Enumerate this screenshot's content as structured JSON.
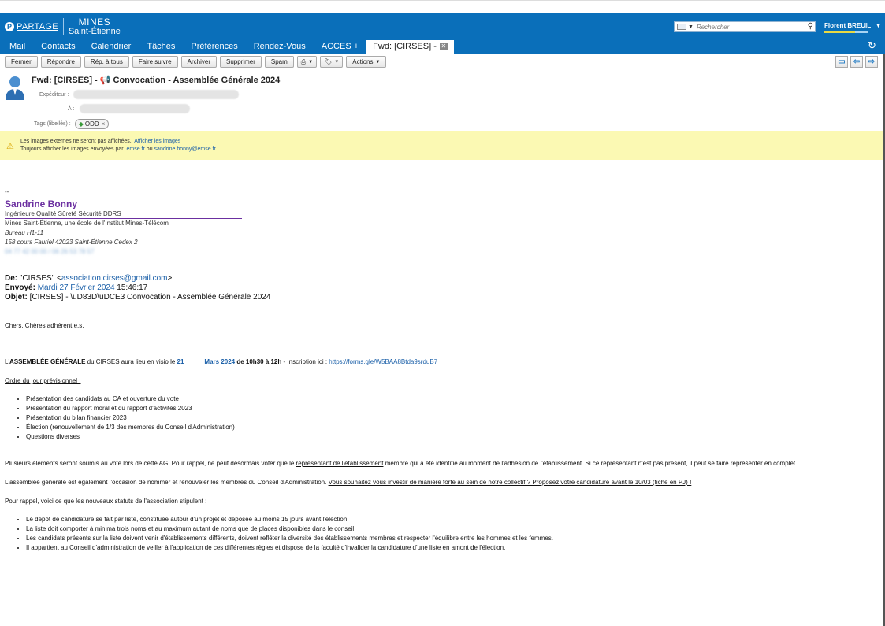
{
  "app": {
    "brand_partage": "PARTAGE",
    "brand_mines_l1": "MINES",
    "brand_mines_l2": "Saint-Étienne",
    "search_placeholder": "Rechercher",
    "user_name": "Florent BREUIL",
    "accent_color": "#0a6fba"
  },
  "tabs": [
    {
      "label": "Mail"
    },
    {
      "label": "Contacts"
    },
    {
      "label": "Calendrier"
    },
    {
      "label": "Tâches"
    },
    {
      "label": "Préférences"
    },
    {
      "label": "Rendez-Vous"
    },
    {
      "label": "ACCES +"
    },
    {
      "label": "Fwd: [CIRSES] -",
      "active": true
    }
  ],
  "toolbar": {
    "close": "Fermer",
    "reply": "Répondre",
    "reply_all": "Rép. à tous",
    "forward": "Faire suivre",
    "archive": "Archiver",
    "delete": "Supprimer",
    "spam": "Spam",
    "actions": "Actions"
  },
  "message": {
    "subject": "Fwd: [CIRSES] - 📢 Convocation - Assemblée Générale 2024",
    "from_label": "Expéditeur :",
    "to_label": "À :",
    "tags_label": "Tags (libellés) :",
    "tag": "ODD"
  },
  "warning": {
    "line1": "Les images externes ne seront pas affichées.",
    "line1_link": "Afficher les images",
    "line2": "Toujours afficher les images envoyées par",
    "line2_link1": "emse.fr",
    "line2_or": "ou",
    "line2_link2": "sandrine.bonny@emse.fr"
  },
  "signature": {
    "dash": "--",
    "name": "Sandrine Bonny",
    "role": "Ingénieure Qualité Sûreté Sécurité DDRS",
    "org": "Mines Saint-Étienne, une école de l'Institut Mines-Télécom",
    "office": "Bureau H1-11",
    "address": "158 cours Fauriel 42023 Saint-Étienne Cedex 2",
    "phone": "04 77 42 00 00 / 06 26 53 78 57"
  },
  "forwarded": {
    "from_label": "De:",
    "from_name": "\"CIRSES\" <",
    "from_email": "association.cirses@gmail.com",
    "from_end": ">",
    "sent_label": "Envoyé:",
    "sent_date": "Mardi 27 Février 2024",
    "sent_time": "15:46:17",
    "subject_label": "Objet:",
    "subject": "[CIRSES] - \\uD83D\\uDCE3 Convocation - Assemblée Générale 2024"
  },
  "body": {
    "greeting": "Chers, Chères adhérent.e.s,",
    "p1_pre": "L'",
    "p1_bold": "ASSEMBLÉE GÉNÉRALE",
    "p1_mid": " du CIRSES aura lieu en visio le ",
    "p1_day": "21",
    "p1_month": "Mars 2024",
    "p1_time": " de 10h30 à 12h",
    "p1_post": " - Inscription ici : ",
    "p1_link": "https://forms.gle/W5BAA8Btda9srduB7",
    "agenda_title": "Ordre du jour prévisionnel :",
    "agenda": [
      "Présentation des candidats au CA et ouverture du vote",
      "Présentation du rapport moral et du rapport d'activités 2023",
      "Présentation du bilan financier 2023",
      "Élection (renouvellement de 1/3 des membres du Conseil d'Administration)",
      "Questions diverses"
    ],
    "p2_pre": "Plusieurs éléments seront soumis au vote lors de cette AG. Pour rappel, ne peut désormais voter que le ",
    "p2_u": "représentant de l'établissement",
    "p2_post": " membre qui a été identifié au moment de l'adhésion de l'établissement. Si ce représentant n'est pas présent, il peut se faire représenter en complét",
    "p3_pre": "L'assemblée générale est également l'occasion de nommer et renouveler les membres du Conseil d'Administration.  ",
    "p3_u": "Vous souhaitez vous investir de manière forte au sein de notre collectif ? Proposez votre candidature avant le 10/03 (fiche en PJ) !",
    "p4": "Pour rappel, voici ce que les nouveaux statuts de l'association stipulent :",
    "rules": [
      "Le dépôt de candidature se fait par liste, constituée autour d'un projet et déposée au moins 15 jours avant l'élection.",
      "La liste doit comporter à minima trois noms et au maximum autant de noms que de places disponibles dans le conseil.",
      "Les candidats présents sur la liste doivent venir d'établissements différents, doivent refléter la diversité des établissements membres et respecter l'équilibre entre les hommes et les femmes.",
      "Il appartient au Conseil d'administration de veiller à l'application de ces différentes règles et dispose de la faculté d'invalider la candidature d'une liste en amont de l'élection."
    ]
  }
}
